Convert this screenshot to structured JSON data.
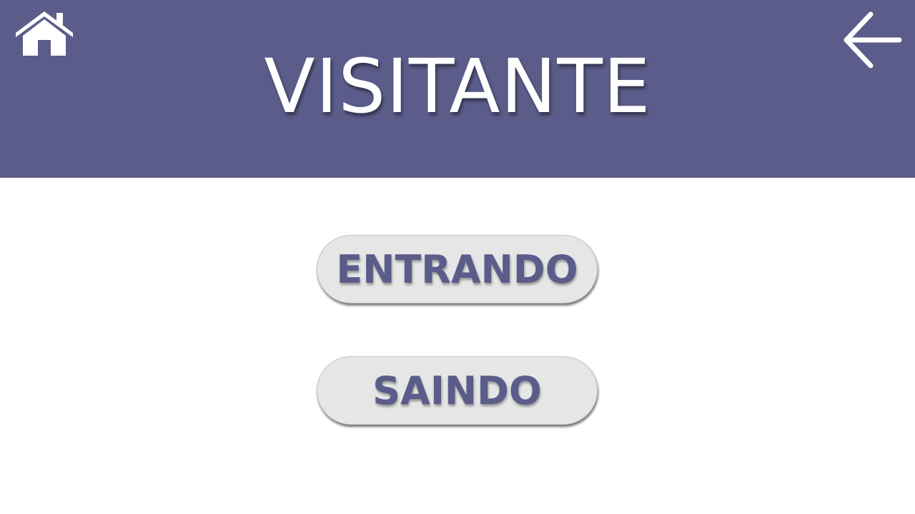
{
  "header": {
    "title": "VISITANTE",
    "home_icon": "home-icon",
    "back_icon": "arrow-left-icon"
  },
  "actions": {
    "entrando_label": "ENTRANDO",
    "saindo_label": "SAINDO"
  },
  "colors": {
    "header_background": "#5b5c8a",
    "accent_text": "#5b5c8a",
    "button_background": "#e6e6e6",
    "page_background": "#ffffff"
  }
}
